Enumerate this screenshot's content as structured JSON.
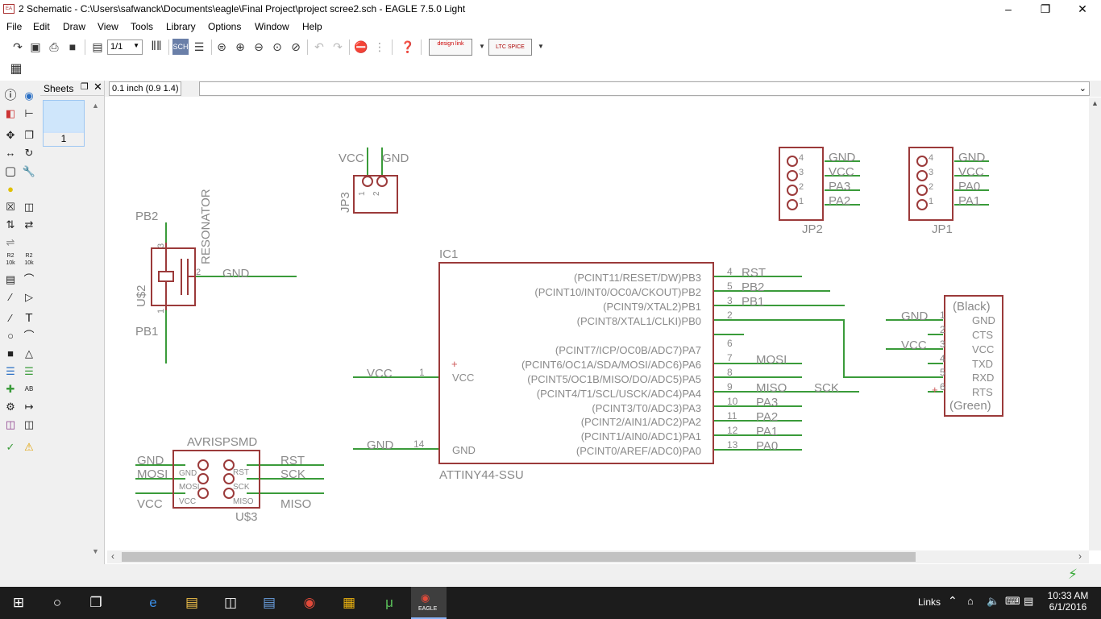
{
  "window": {
    "title": "2 Schematic - C:\\Users\\safwanck\\Documents\\eagle\\Final Project\\project scree2.sch - EAGLE 7.5.0 Light",
    "app_icon": "eagle-icon"
  },
  "menu": [
    "File",
    "Edit",
    "Draw",
    "View",
    "Tools",
    "Library",
    "Options",
    "Window",
    "Help"
  ],
  "toolbar": {
    "sheet_select": "1/1",
    "designlink_label": "design link",
    "ltspice_label": "LTC SPICE"
  },
  "sheets_panel": {
    "title": "Sheets",
    "sheet_number": "1"
  },
  "coordinate_display": "0.1 inch (0.9 1.4)",
  "left_tools": {
    "value_label": "R2 10k",
    "value_label2": "R2 10k",
    "text_tool": "T",
    "name_tool": "AB"
  },
  "schematic": {
    "jp3": {
      "name": "JP3",
      "pins": [
        "1",
        "2"
      ],
      "nets": [
        "VCC",
        "GND"
      ]
    },
    "jp2": {
      "name": "JP2",
      "pins": [
        "4",
        "3",
        "2",
        "1"
      ],
      "nets": [
        "GND",
        "VCC",
        "PA3",
        "PA2"
      ]
    },
    "jp1": {
      "name": "JP1",
      "pins": [
        "4",
        "3",
        "2",
        "1"
      ],
      "nets": [
        "GND",
        "VCC",
        "PA0",
        "PA1"
      ]
    },
    "resonator": {
      "name": "U$2",
      "value": "RESONATOR",
      "pins": [
        "3",
        "2",
        "1"
      ],
      "nets": [
        "PB2",
        "GND",
        "PB1"
      ]
    },
    "ic1": {
      "name": "IC1",
      "value": "ATTINY44-SSU",
      "left_pins": [
        {
          "num": "1",
          "label": "VCC",
          "net": "VCC"
        },
        {
          "num": "14",
          "label": "GND",
          "net": "GND"
        }
      ],
      "right_pins": [
        {
          "label": "(PCINT11/RESET/DW)PB3",
          "num": "4",
          "net": "RST"
        },
        {
          "label": "(PCINT10/INT0/OC0A/CKOUT)PB2",
          "num": "5",
          "net": "PB2"
        },
        {
          "label": "(PCINT9/XTAL2)PB1",
          "num": "3",
          "net": "PB1"
        },
        {
          "label": "(PCINT8/XTAL1/CLKI)PB0",
          "num": "2",
          "net": ""
        },
        {
          "label": "(PCINT7/ICP/OC0B/ADC7)PA7",
          "num": "6",
          "net": ""
        },
        {
          "label": "(PCINT6/OC1A/SDA/MOSI/ADC6)PA6",
          "num": "7",
          "net": "MOSI"
        },
        {
          "label": "(PCINT5/OC1B/MISO/DO/ADC5)PA5",
          "num": "8",
          "net": ""
        },
        {
          "label": "(PCINT4/T1/SCL/USCK/ADC4)PA4",
          "num": "9",
          "net": "MISO"
        },
        {
          "label": "(PCINT3/T0/ADC3)PA3",
          "num": "10",
          "net": "PA3"
        },
        {
          "label": "(PCINT2/AIN1/ADC2)PA2",
          "num": "11",
          "net": "PA2"
        },
        {
          "label": "(PCINT1/AIN0/ADC1)PA1",
          "num": "12",
          "net": "PA1"
        },
        {
          "label": "(PCINT0/AREF/ADC0)PA0",
          "num": "13",
          "net": "PA0"
        }
      ],
      "extra_net": "SCK"
    },
    "ftdi": {
      "top": "(Black)",
      "bottom": "(Green)",
      "pins": [
        {
          "num": "1",
          "label": "GND",
          "net": "GND"
        },
        {
          "num": "2",
          "label": "CTS",
          "net": ""
        },
        {
          "num": "3",
          "label": "VCC",
          "net": "VCC"
        },
        {
          "num": "4",
          "label": "TXD",
          "net": ""
        },
        {
          "num": "5",
          "label": "RXD",
          "net": ""
        },
        {
          "num": "6",
          "label": "RTS",
          "net": ""
        }
      ]
    },
    "avrisp": {
      "name": "U$3",
      "value": "AVRISPSMD",
      "left_nets": [
        "GND",
        "MOSI",
        "VCC"
      ],
      "right_nets": [
        "RST",
        "SCK",
        "MISO"
      ],
      "left_pin_labels": [
        "GND",
        "MOSI",
        "VCC"
      ],
      "right_pin_labels": [
        "RST",
        "SCK",
        "MISO"
      ]
    }
  },
  "colors": {
    "symbol": "#9b3a3a",
    "wire": "#3a9b3a",
    "text": "#8a8a8a",
    "accent": "#0a66cc"
  },
  "taskbar": {
    "links_label": "Links",
    "time": "10:33 AM",
    "date": "6/1/2016",
    "eagle_label": "EAGLE"
  }
}
